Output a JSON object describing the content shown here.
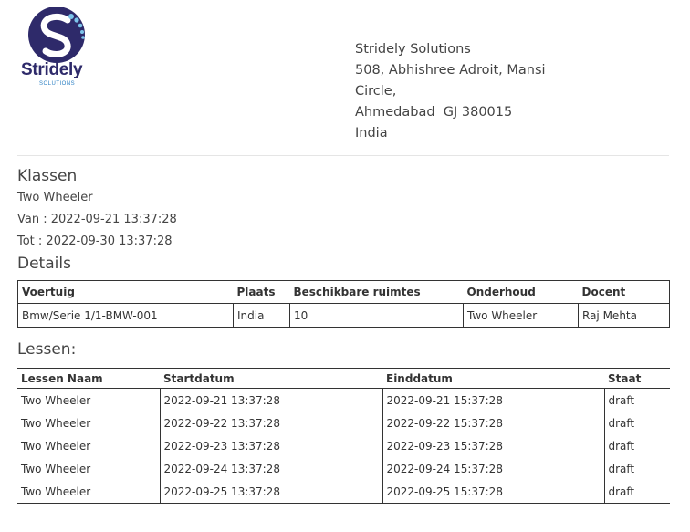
{
  "company": {
    "logo_name": "Stridely",
    "logo_sub": "SOLUTIONS",
    "address_lines": [
      "Stridely Solutions",
      "508, Abhishree Adroit, Mansi",
      "Circle,",
      "Ahmedabad  GJ 380015",
      "India"
    ]
  },
  "klassen": {
    "heading": "Klassen",
    "name": "Two Wheeler",
    "van": "Van : 2022-09-21 13:37:28",
    "tot": "Tot : 2022-09-30 13:37:28"
  },
  "details": {
    "heading": "Details",
    "headers": [
      "Voertuig",
      "Plaats",
      "Beschikbare ruimtes",
      "Onderhoud",
      "Docent"
    ],
    "row": [
      "Bmw/Serie 1/1-BMW-001",
      "India",
      "10",
      "Two Wheeler",
      "Raj Mehta"
    ]
  },
  "lessen": {
    "heading": "Lessen:",
    "headers": [
      "Lessen Naam",
      "Startdatum",
      "Einddatum",
      "Staat"
    ],
    "rows": [
      [
        "Two Wheeler",
        "2022-09-21 13:37:28",
        "2022-09-21 15:37:28",
        "draft"
      ],
      [
        "Two Wheeler",
        "2022-09-22 13:37:28",
        "2022-09-22 15:37:28",
        "draft"
      ],
      [
        "Two Wheeler",
        "2022-09-23 13:37:28",
        "2022-09-23 15:37:28",
        "draft"
      ],
      [
        "Two Wheeler",
        "2022-09-24 13:37:28",
        "2022-09-24 15:37:28",
        "draft"
      ],
      [
        "Two Wheeler",
        "2022-09-25 13:37:28",
        "2022-09-25 15:37:28",
        "draft"
      ]
    ]
  }
}
